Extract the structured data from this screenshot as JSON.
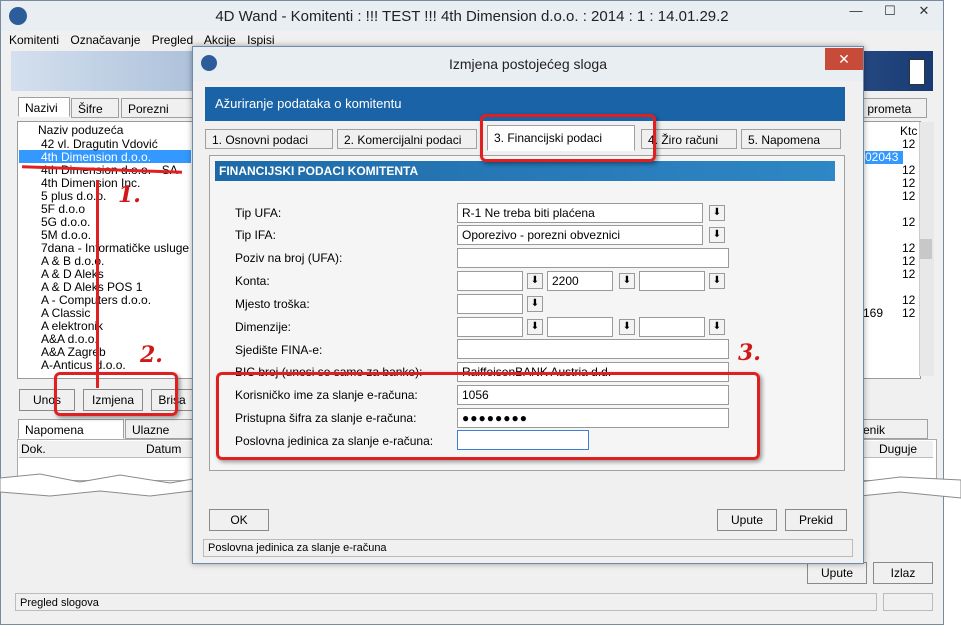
{
  "window": {
    "title": "4D Wand - Komitenti : !!! TEST !!! 4th Dimension d.o.o. : 2014 : 1 : 14.01.29.2",
    "minimize": "—",
    "maximize": "☐",
    "close": "✕"
  },
  "menu": [
    "Komitenti",
    "Označavanje",
    "Pregled",
    "Akcije",
    "Ispisi"
  ],
  "main_tabs": [
    "Nazivi",
    "Šifre",
    "Porezni broj"
  ],
  "right_tab": "z prometa",
  "list": {
    "header": "Naziv poduzeća",
    "right_header": "Ktc",
    "items": [
      "42 vl. Dragutin Vdović",
      "4th Dimension d.o.o.",
      "4th Dimension d.o.o. - SA",
      "4th Dimension Inc.",
      "5 plus d.o.o.",
      "5F d.o.o",
      "5G d.o.o.",
      "5M d.o.o.",
      "7dana - Informatičke usluge",
      "A & B d.o.o.",
      "A & D Aleks",
      "A & D Aleks POS 1",
      "A - Computers d.o.o.",
      "A Classic",
      "A elektronik",
      "A&A d.o.o.",
      "A&A Zagreb",
      "A-Anticus d.o.o."
    ],
    "right_values": [
      "12",
      "02043",
      "12",
      "12",
      "12",
      "12",
      "12",
      "12",
      "12",
      "12",
      "169",
      "12"
    ]
  },
  "main_buttons": {
    "unos": "Unos",
    "izmjena": "Izmjena",
    "brisanje": "Brisa"
  },
  "bottom_tabs": [
    "Napomena",
    "Ulazne fak"
  ],
  "bottom_right_tab": "enik",
  "grid_headers": {
    "dok": "Dok.",
    "datum": "Datum",
    "duguje": "Duguje"
  },
  "main_footer_buttons": {
    "upute": "Upute",
    "izlaz": "Izlaz"
  },
  "status": "Pregled slogova",
  "dialog": {
    "title": "Izmjena postojećeg sloga",
    "header": "Ažuriranje podataka o komitentu",
    "tabs": [
      "1. Osnovni podaci",
      "2. Komercijalni podaci",
      "3. Financijski podaci",
      "4. Žiro računi",
      "5. Napomena"
    ],
    "section": "FINANCIJSKI PODACI KOMITENTA",
    "fields": {
      "tip_ufa_label": "Tip UFA:",
      "tip_ufa_value": "R-1 Ne treba biti plaćena",
      "tip_ifa_label": "Tip IFA:",
      "tip_ifa_value": "Oporezivo - porezni obveznici",
      "poziv_label": "Poziv na broj (UFA):",
      "konta_label": "Konta:",
      "konta_value2": "2200",
      "mjesto_label": "Mjesto troška:",
      "dimenzije_label": "Dimenzije:",
      "sjediste_label": "Sjedište FINA-e:",
      "bic_label": "BIC broj (unosi se samo za banke):",
      "bic_value": "RaiffeisenBANK Austria d.d.",
      "korisnicko_label": "Korisničko ime za slanje e-računa:",
      "korisnicko_value": "1056",
      "sifra_label": "Pristupna šifra za slanje e-računa:",
      "sifra_value": "●●●●●●●●",
      "poslovna_label": "Poslovna jedinica za slanje e-računa:"
    },
    "buttons": {
      "ok": "OK",
      "upute": "Upute",
      "prekid": "Prekid"
    },
    "status": "Poslovna jedinica za slanje e-računa"
  },
  "annotations": [
    "1.",
    "2.",
    "3."
  ],
  "colors": {
    "annotation_red": "#e02020",
    "dialog_header_blue": "#1a63a6",
    "selection_blue": "#3399ff"
  }
}
